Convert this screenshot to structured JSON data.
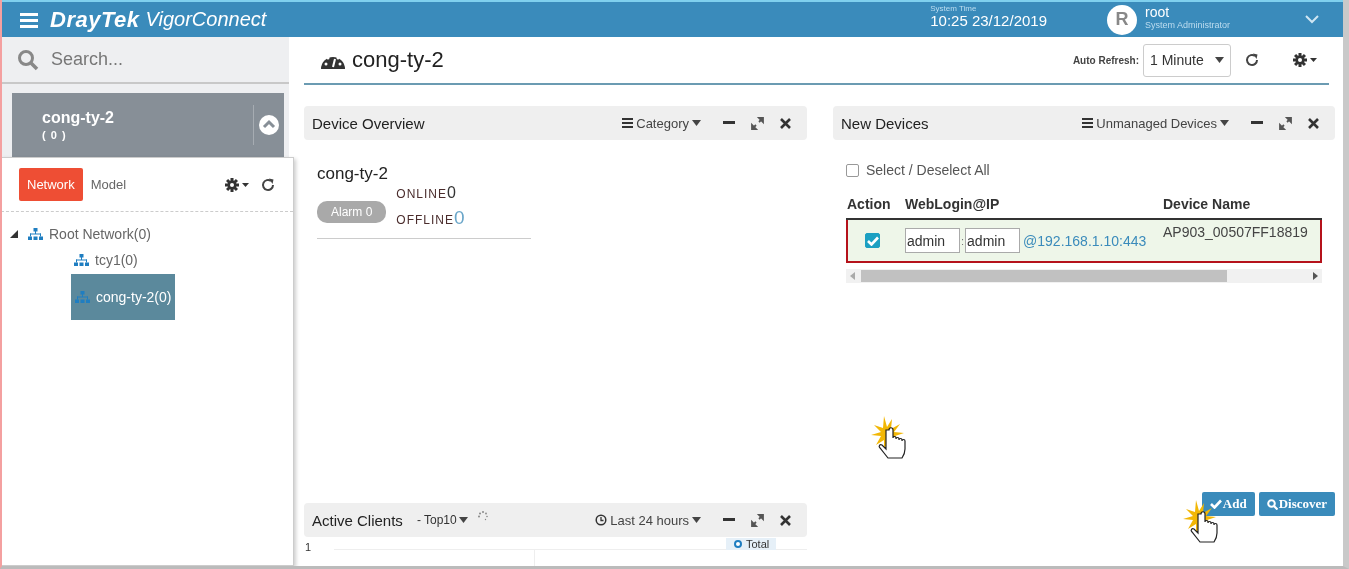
{
  "header": {
    "brand": "DrayTek",
    "product": "VigorConnect",
    "system_time_label": "System Time",
    "system_time": "10:25 23/12/2019",
    "user": {
      "initial": "R",
      "name": "root",
      "role": "System Administrator"
    }
  },
  "sidebar": {
    "search": {
      "placeholder": "Search..."
    },
    "group": {
      "name": "cong-ty-2",
      "count": "( 0 )",
      "expanded": true
    },
    "tabs": [
      {
        "label": "Network",
        "selected": true
      },
      {
        "label": "Model",
        "selected": false
      }
    ],
    "tree": [
      {
        "label": "Root Network(0)",
        "expanded": true,
        "selected": false,
        "children": [
          {
            "label": "tcy1(0)",
            "selected": false
          },
          {
            "label": "cong-ty-2(0)",
            "selected": true
          }
        ]
      }
    ]
  },
  "page": {
    "title": "cong-ty-2",
    "auto_refresh_label": "Auto Refresh:",
    "auto_refresh_value": "1 Minute"
  },
  "device_overview": {
    "title": "Device Overview",
    "menu": "Category",
    "group_name": "cong-ty-2",
    "alarm": "Alarm 0",
    "statuses": [
      {
        "label": "ONLINE",
        "count": "0"
      },
      {
        "label": "OFFLINE",
        "count": "0"
      }
    ]
  },
  "new_devices": {
    "title": "New Devices",
    "menu": "Unmanaged Devices",
    "select_all": {
      "label": "Select / Deselect All",
      "checked": false
    },
    "columns": [
      "Action",
      "WebLogin@IP",
      "Device Name"
    ],
    "rows": [
      {
        "checked": true,
        "highlighted": true,
        "username": "admin",
        "separator": ":",
        "password": "admin",
        "address": "@192.168.1.10:443",
        "device_name": "AP903_00507FF18819"
      }
    ],
    "buttons": [
      {
        "label": "Add",
        "kind": "add"
      },
      {
        "label": "Discover",
        "kind": "discover"
      }
    ]
  },
  "active_clients": {
    "title": "Active Clients",
    "filter": "- Top10",
    "range": "Last 24 hours",
    "y_tick": "1",
    "legend": "Total"
  }
}
